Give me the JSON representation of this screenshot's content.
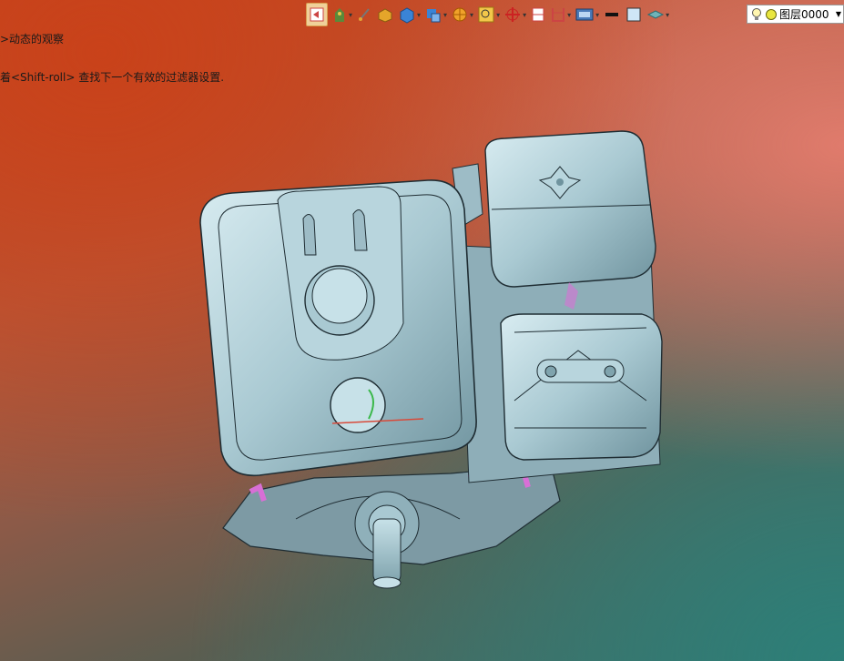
{
  "command_prompt": {
    "line1": ">动态的观察",
    "line2": "着<Shift-roll> 查找下一个有效的过滤器设置."
  },
  "toolbar": {
    "icons": [
      "undo-view-icon",
      "pan-icon",
      "snap-point-icon",
      "shaded-solid-icon",
      "solid-box-icon",
      "view-orientation-icon",
      "snap-icon",
      "zoom-icon",
      "move-icon",
      "section-view-icon",
      "frame-icon",
      "display-icon",
      "line-style-icon",
      "color-swatch-icon",
      "layer-display-icon",
      "lightbulb-icon",
      "layer-color-icon"
    ],
    "layer_select": "图层0000"
  },
  "colors": {
    "model_fill": "#a9c9d2",
    "model_edge": "#1f2d33",
    "bg_top_left": "#c9421a",
    "bg_bottom_right": "#2d7f78"
  }
}
